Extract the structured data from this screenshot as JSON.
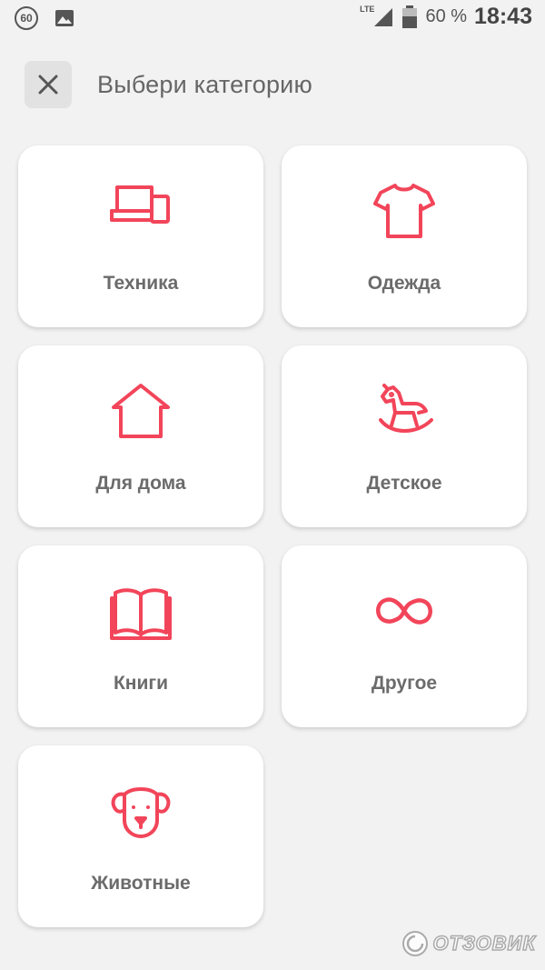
{
  "status_bar": {
    "badge": "60",
    "network": "LTE",
    "battery": "60 %",
    "time": "18:43"
  },
  "header": {
    "title": "Выбери категорию"
  },
  "categories": [
    {
      "label": "Техника",
      "icon": "laptop-phone-icon"
    },
    {
      "label": "Одежда",
      "icon": "tshirt-icon"
    },
    {
      "label": "Для дома",
      "icon": "house-icon"
    },
    {
      "label": "Детское",
      "icon": "rocking-horse-icon"
    },
    {
      "label": "Книги",
      "icon": "book-icon"
    },
    {
      "label": "Другое",
      "icon": "infinity-icon"
    },
    {
      "label": "Животные",
      "icon": "dog-icon"
    }
  ],
  "watermark": {
    "text": "ОТЗОВИК"
  },
  "colors": {
    "accent": "#f2455a",
    "background": "#f2f2f2",
    "card": "#ffffff",
    "label": "#6b6b6b"
  }
}
